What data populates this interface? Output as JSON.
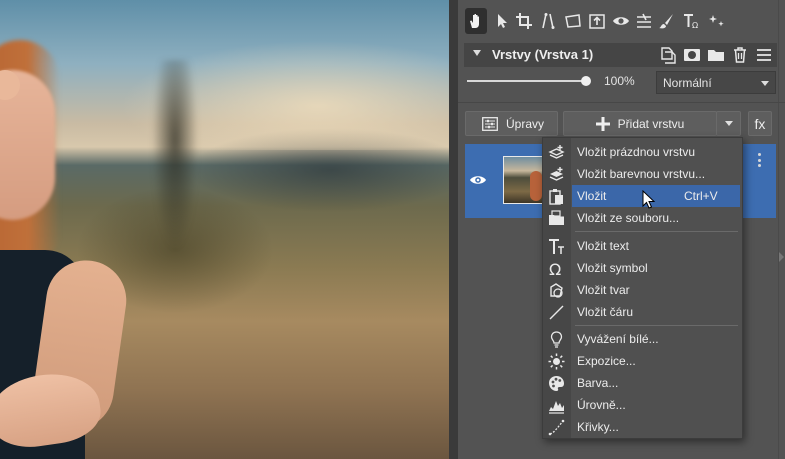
{
  "toolbar": {
    "tools": [
      "hand-tool",
      "select-tool",
      "crop-tool",
      "transform-tool",
      "perspective-tool",
      "export-tool",
      "visibility-tool",
      "adjust-tool",
      "brush-tool",
      "text-tool",
      "magic-tool"
    ]
  },
  "layers_panel": {
    "title": "Vrstvy (Vrstva 1)",
    "opacity": "100%",
    "blend_mode": "Normální",
    "adjustments_label": "Úpravy",
    "add_layer_label": "Přidat vrstvu",
    "fx_label": "fx"
  },
  "menu": {
    "items": [
      {
        "label": "Vložit prázdnou vrstvu",
        "icon": "layer-add-icon"
      },
      {
        "label": "Vložit barevnou vrstvu...",
        "icon": "layer-color-icon"
      },
      {
        "label": "Vložit",
        "shortcut": "Ctrl+V",
        "icon": "paste-icon"
      },
      {
        "label": "Vložit ze souboru...",
        "icon": "folder-icon"
      },
      {
        "label": "Vložit text",
        "icon": "text-icon"
      },
      {
        "label": "Vložit symbol",
        "icon": "omega-icon"
      },
      {
        "label": "Vložit tvar",
        "icon": "shape-icon"
      },
      {
        "label": "Vložit čáru",
        "icon": "line-icon"
      },
      {
        "label": "Vyvážení bílé...",
        "icon": "bulb-icon"
      },
      {
        "label": "Expozice...",
        "icon": "sun-icon"
      },
      {
        "label": "Barva...",
        "icon": "palette-icon"
      },
      {
        "label": "Úrovně...",
        "icon": "histogram-icon"
      },
      {
        "label": "Křivky...",
        "icon": "curve-icon"
      }
    ]
  },
  "colors": {
    "accent": "#3b67a9",
    "panel": "#535353",
    "selected_layer": "#3d6db1"
  }
}
